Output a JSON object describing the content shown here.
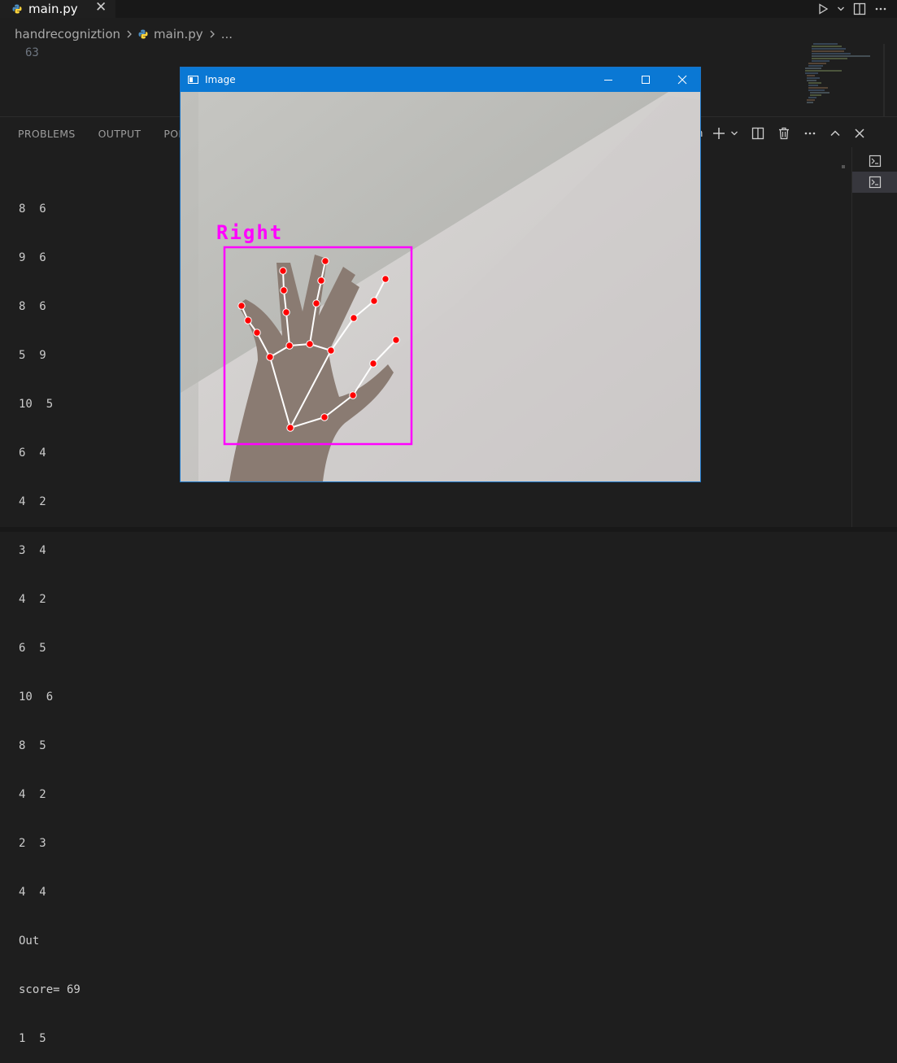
{
  "tab": {
    "label": "main.py",
    "close": "✕"
  },
  "breadcrumb": {
    "folder": "handrecogniztion",
    "file": "main.py",
    "more": "..."
  },
  "editor": {
    "line_number": "63"
  },
  "panel": {
    "tabs": [
      "PROBLEMS",
      "OUTPUT",
      "PORT"
    ],
    "terminal_label_partial": "hon"
  },
  "terminal_lines": [
    "8  6",
    "9  6",
    "8  6",
    "5  9",
    "10  5",
    "6  4",
    "4  2",
    "3  4",
    "4  2",
    "6  5",
    "10  6",
    "8  5",
    "4  2",
    "2  3",
    "4  4",
    "Out",
    "score= 69",
    "1  5"
  ],
  "image_window": {
    "title": "Image",
    "handedness_label": "Right",
    "colors": {
      "titlebar": "#0a78d4",
      "box": "#ff00ff",
      "landmark": "#ff0000",
      "connection": "#ffffff"
    }
  }
}
